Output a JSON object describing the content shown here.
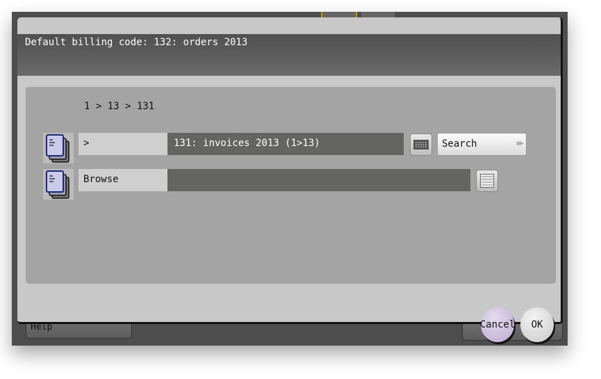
{
  "dialog": {
    "title": "Default billing code: 132: orders 2013"
  },
  "breadcrumb": "1 > 13 > 131",
  "rows": [
    {
      "label": ">",
      "value": "131: invoices 2013 (1>13)",
      "search_label": "Search"
    },
    {
      "label": "Browse",
      "value": ""
    }
  ],
  "buttons": {
    "cancel": "Cancel",
    "ok": "OK",
    "help": "Help"
  }
}
